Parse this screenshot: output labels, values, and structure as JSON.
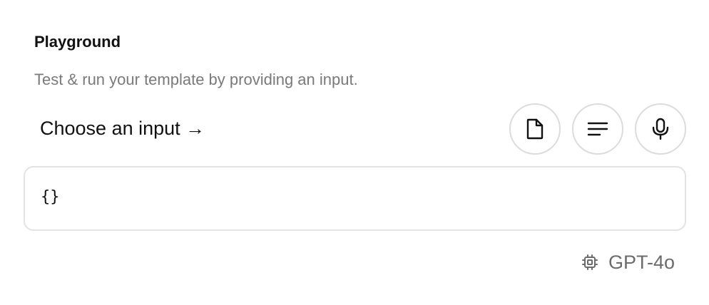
{
  "panel": {
    "title": "Playground",
    "subtitle": "Test & run your template by providing an input.",
    "choose_input_label": "Choose an input →",
    "input_buttons": [
      {
        "icon": "file-icon"
      },
      {
        "icon": "text-lines-icon"
      },
      {
        "icon": "microphone-icon"
      }
    ],
    "input_value": "{}",
    "model": {
      "icon": "chip-icon",
      "name": "GPT-4o"
    }
  }
}
